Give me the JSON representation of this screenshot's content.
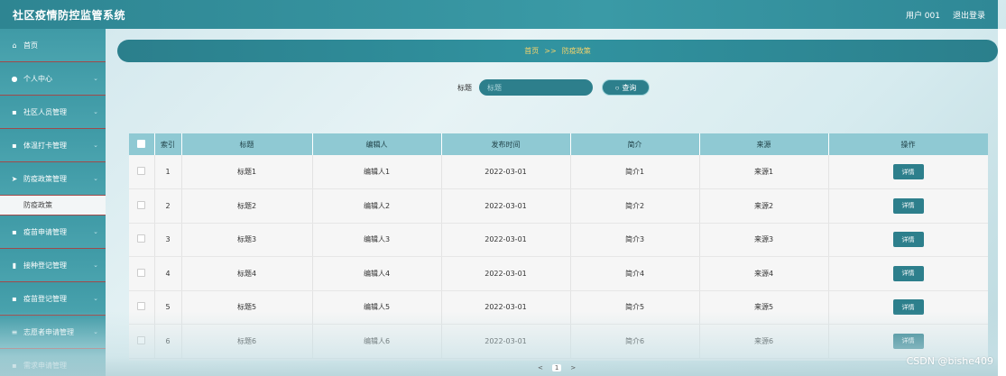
{
  "app": {
    "title": "社区疫情防控监管系统"
  },
  "header": {
    "user_label": "用户 001",
    "logout_label": "退出登录"
  },
  "sidebar": {
    "items": [
      {
        "label": "首页",
        "icon": "home-icon",
        "glyph": "⌂",
        "chevron": false
      },
      {
        "label": "个人中心",
        "icon": "user-icon",
        "glyph": "●",
        "chevron": true
      },
      {
        "label": "社区人员管理",
        "icon": "grid-icon",
        "glyph": "▪",
        "chevron": true
      },
      {
        "label": "体温打卡管理",
        "icon": "grid-icon",
        "glyph": "▪",
        "chevron": true
      },
      {
        "label": "防疫政策管理",
        "icon": "send-icon",
        "glyph": "➤",
        "chevron": true,
        "expanded": true
      },
      {
        "label": "疫苗申请管理",
        "icon": "grid-icon",
        "glyph": "▪",
        "chevron": true
      },
      {
        "label": "接种登记管理",
        "icon": "trash-icon",
        "glyph": "▮",
        "chevron": true
      },
      {
        "label": "疫苗登记管理",
        "icon": "grid-icon",
        "glyph": "▪",
        "chevron": true
      },
      {
        "label": "志愿者申请管理",
        "icon": "list-icon",
        "glyph": "≡",
        "chevron": true
      },
      {
        "label": "需求申请管理",
        "icon": "grid-icon",
        "glyph": "▪",
        "chevron": false
      }
    ],
    "sub_item": "防疫政策"
  },
  "breadcrumb": {
    "home": "首页",
    "separator": ">>",
    "current": "防疫政策"
  },
  "search": {
    "label": "标题",
    "placeholder": "标题",
    "button_label": "查询"
  },
  "table": {
    "headers": [
      "索引",
      "标题",
      "编辑人",
      "发布时间",
      "简介",
      "来源",
      "操作"
    ],
    "rows": [
      {
        "index": "1",
        "title": "标题1",
        "editor": "编辑人1",
        "date": "2022-03-01",
        "intro": "简介1",
        "source": "来源1",
        "action": "详情"
      },
      {
        "index": "2",
        "title": "标题2",
        "editor": "编辑人2",
        "date": "2022-03-01",
        "intro": "简介2",
        "source": "来源2",
        "action": "详情"
      },
      {
        "index": "3",
        "title": "标题3",
        "editor": "编辑人3",
        "date": "2022-03-01",
        "intro": "简介3",
        "source": "来源3",
        "action": "详情"
      },
      {
        "index": "4",
        "title": "标题4",
        "editor": "编辑人4",
        "date": "2022-03-01",
        "intro": "简介4",
        "source": "来源4",
        "action": "详情"
      },
      {
        "index": "5",
        "title": "标题5",
        "editor": "编辑人5",
        "date": "2022-03-01",
        "intro": "简介5",
        "source": "来源5",
        "action": "详情"
      },
      {
        "index": "6",
        "title": "标题6",
        "editor": "编辑人6",
        "date": "2022-03-01",
        "intro": "简介6",
        "source": "来源6",
        "action": "详情"
      }
    ]
  },
  "pager": {
    "prev": "<",
    "page": "1",
    "next": ">"
  },
  "watermark": "CSDN @bishe409"
}
